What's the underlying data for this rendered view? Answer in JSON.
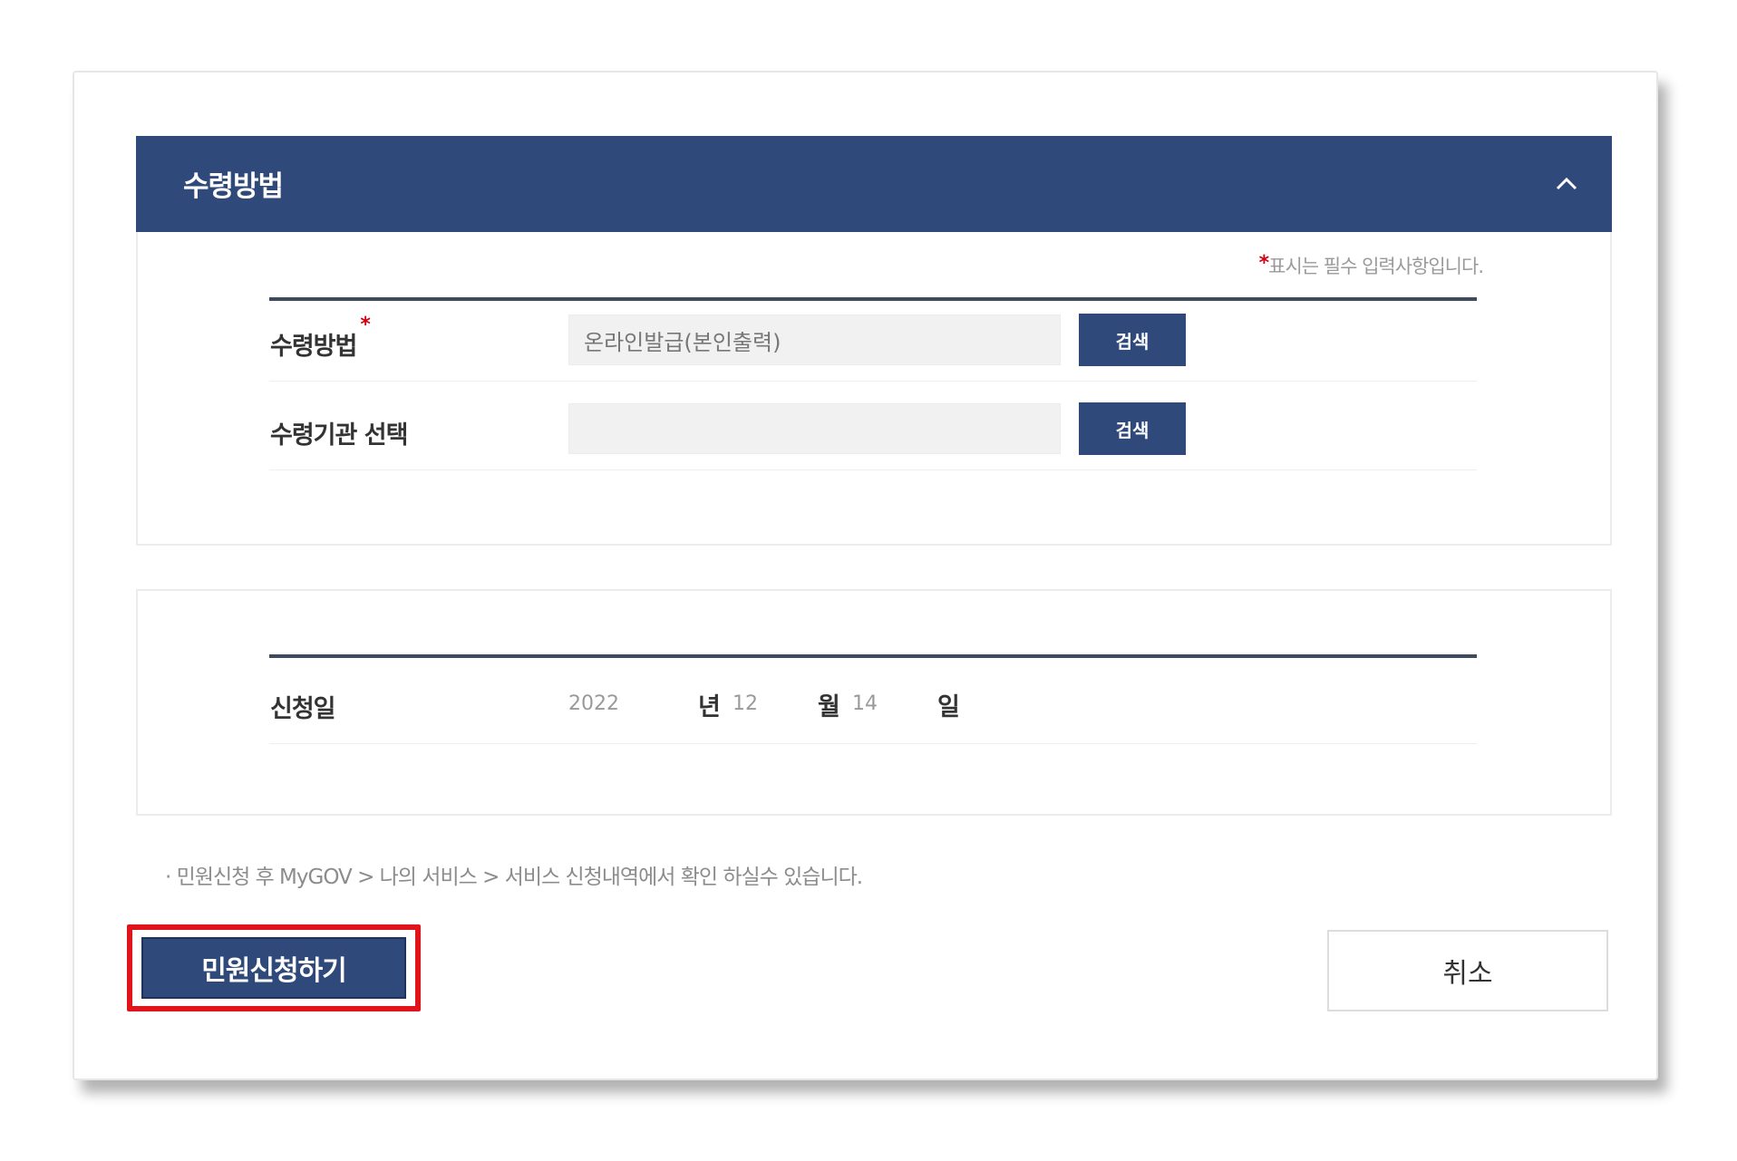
{
  "panel1": {
    "title": "수령방법",
    "required_note": "표시는 필수 입력사항입니다.",
    "rows": [
      {
        "label": "수령방법",
        "value": "온라인발급(본인출력)",
        "button": "검색"
      },
      {
        "label": "수령기관 선택",
        "value": "",
        "button": "검색"
      }
    ]
  },
  "panel2": {
    "label": "신청일",
    "year": "2022",
    "year_unit": "년",
    "month": "12",
    "month_unit": "월",
    "day": "14",
    "day_unit": "일"
  },
  "footnote": "· 민원신청 후 MyGOV > 나의 서비스 > 서비스 신청내역에서 확인 하실수 있습니다.",
  "actions": {
    "submit_label": "민원신청하기",
    "cancel_label": "취소"
  },
  "colors": {
    "primary": "#2f4a7a",
    "highlight": "#e1141c",
    "required": "#d4000f"
  }
}
